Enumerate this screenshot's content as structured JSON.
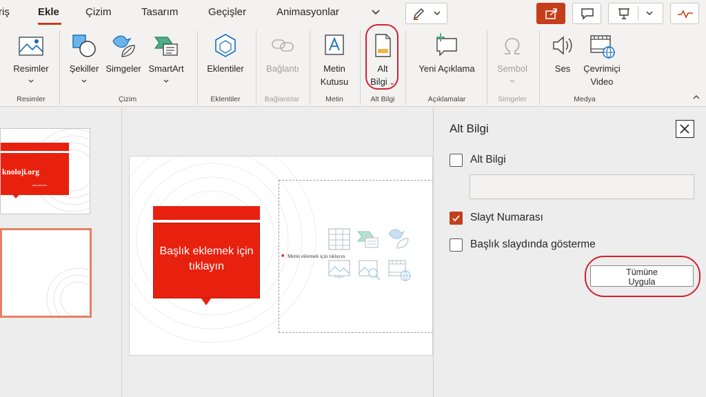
{
  "tabs": [
    "riş",
    "Ekle",
    "Çizim",
    "Tasarım",
    "Geçişler",
    "Animasyonlar"
  ],
  "active_tab": "Ekle",
  "accent_color": "#c43e1c",
  "slide_red": "#e8210f",
  "highlight_color": "#d0202e",
  "ribbon": {
    "buttons": {
      "resimler": "Resimler",
      "sekiller": "Şekiller",
      "simgeler": "Simgeler",
      "smartart": "SmartArt",
      "eklentiler": "Eklentiler",
      "baglanti": "Bağlantı",
      "metin_kutusu_1": "Metin",
      "metin_kutusu_2": "Kutusu",
      "alt_bilgi_1": "Alt",
      "alt_bilgi_2": "Bilgi",
      "yeni_aciklama": "Yeni Açıklama",
      "sembol": "Sembol",
      "ses": "Ses",
      "cevrimici_1": "Çevrimiçi",
      "cevrimici_2": "Video"
    },
    "groups": {
      "resimler": "Resimler",
      "cizim": "Çizim",
      "eklentiler": "Eklentiler",
      "baglantilar": "Bağlantılar",
      "metin": "Metin",
      "alt_bilgi": "Alt Bilgi",
      "aciklamalar": "Açıklamalar",
      "simgeler": "Simgeler",
      "medya": "Medya"
    }
  },
  "thumbnail": {
    "site_text": "knoloji.org",
    "small_text": "aaa.nnnnnn"
  },
  "slide": {
    "title_placeholder": "Başlık eklemek için tıklayın",
    "content_placeholder": "Metin eklemek için tıklayın"
  },
  "pane": {
    "title": "Alt Bilgi",
    "alt_bilgi_label": "Alt Bilgi",
    "alt_bilgi_checked": false,
    "footer_value": "",
    "slayt_numarasi_label": "Slayt Numarası",
    "slayt_numarasi_checked": true,
    "baslik_slayt_label": "Başlık slaydında gösterme",
    "baslik_slayt_checked": false,
    "apply_line1": "Tümüne",
    "apply_line2": "Uygula"
  }
}
